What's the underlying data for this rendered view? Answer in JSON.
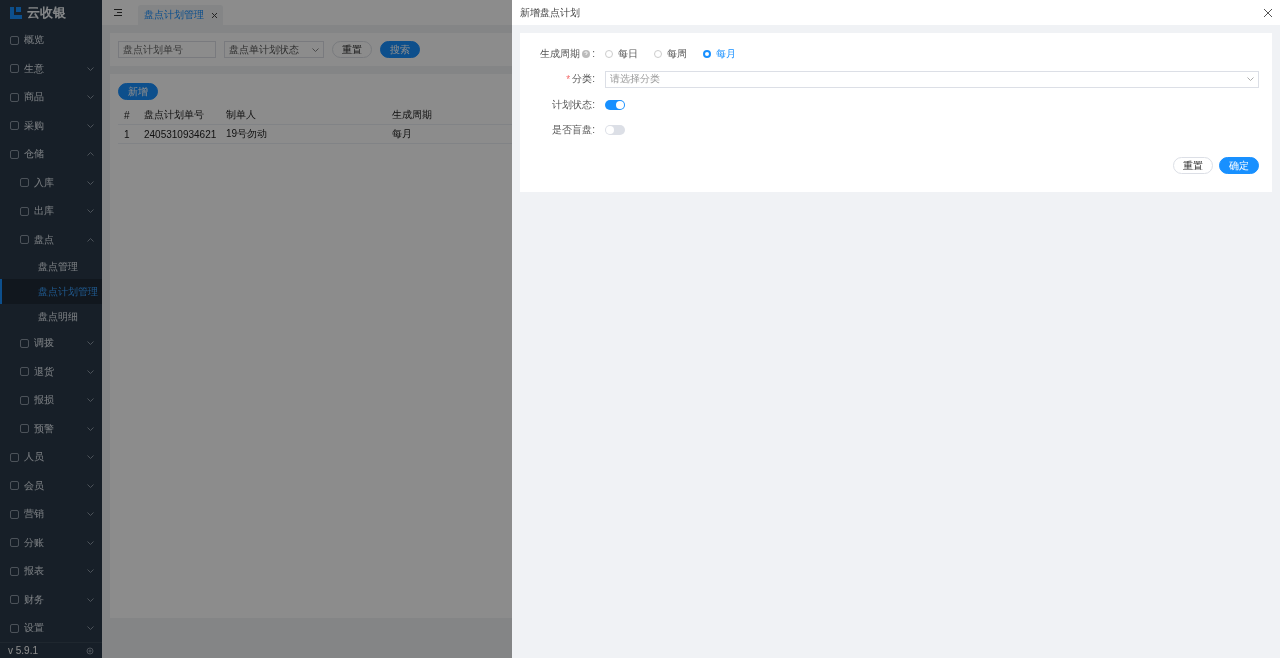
{
  "brand": {
    "name": "云收银"
  },
  "sidebar": {
    "items": [
      {
        "kind": "link",
        "label": "概览"
      },
      {
        "kind": "submenu",
        "label": "生意",
        "expanded": false
      },
      {
        "kind": "submenu",
        "label": "商品",
        "expanded": false
      },
      {
        "kind": "submenu",
        "label": "采购",
        "expanded": false
      },
      {
        "kind": "submenu",
        "label": "仓储",
        "expanded": true,
        "children": [
          {
            "kind": "submenu",
            "label": "入库",
            "expanded": false
          },
          {
            "kind": "submenu",
            "label": "出库",
            "expanded": false
          },
          {
            "kind": "submenu",
            "label": "盘点",
            "expanded": true,
            "children": [
              {
                "kind": "page",
                "label": "盘点管理",
                "selected": false
              },
              {
                "kind": "page",
                "label": "盘点计划管理",
                "selected": true
              },
              {
                "kind": "page",
                "label": "盘点明细",
                "selected": false
              }
            ]
          },
          {
            "kind": "submenu",
            "label": "调拨",
            "expanded": false
          },
          {
            "kind": "submenu",
            "label": "退货",
            "expanded": false
          },
          {
            "kind": "submenu",
            "label": "报损",
            "expanded": false
          },
          {
            "kind": "submenu",
            "label": "预警",
            "expanded": false
          }
        ]
      },
      {
        "kind": "submenu",
        "label": "人员",
        "expanded": false
      },
      {
        "kind": "submenu",
        "label": "会员",
        "expanded": false
      },
      {
        "kind": "submenu",
        "label": "营销",
        "expanded": false
      },
      {
        "kind": "submenu",
        "label": "分账",
        "expanded": false
      },
      {
        "kind": "submenu",
        "label": "报表",
        "expanded": false
      },
      {
        "kind": "submenu",
        "label": "财务",
        "expanded": false
      },
      {
        "kind": "submenu",
        "label": "设置",
        "expanded": false
      }
    ],
    "version": "v 5.9.1"
  },
  "tabs": [
    {
      "label": "盘点计划管理",
      "selected": true
    }
  ],
  "search": {
    "plan_no": {
      "placeholder": "盘点计划单号"
    },
    "status": {
      "placeholder": "盘点单计划状态"
    },
    "buttons": [
      "重置",
      "搜索"
    ]
  },
  "table": {
    "add_button": "新增",
    "columns": [
      "#",
      "盘点计划单号",
      "制单人",
      "生成周期"
    ],
    "rows": [
      [
        "1",
        "2405310934621",
        "19号勿动",
        "每月"
      ]
    ]
  },
  "drawer": {
    "title": "新增盘点计划",
    "cycle": {
      "label": "生成周期",
      "colon": ":",
      "options": [
        {
          "label": "每日",
          "selected": false
        },
        {
          "label": "每周",
          "selected": false
        },
        {
          "label": "每月",
          "selected": true
        }
      ]
    },
    "category": {
      "required_mark": "*",
      "label": "分类:",
      "placeholder": "请选择分类"
    },
    "toggles": [
      {
        "label": "计划状态:",
        "on": true
      },
      {
        "label": "是否盲盘:",
        "on": false
      }
    ],
    "buttons": [
      "重置",
      "确定"
    ]
  }
}
